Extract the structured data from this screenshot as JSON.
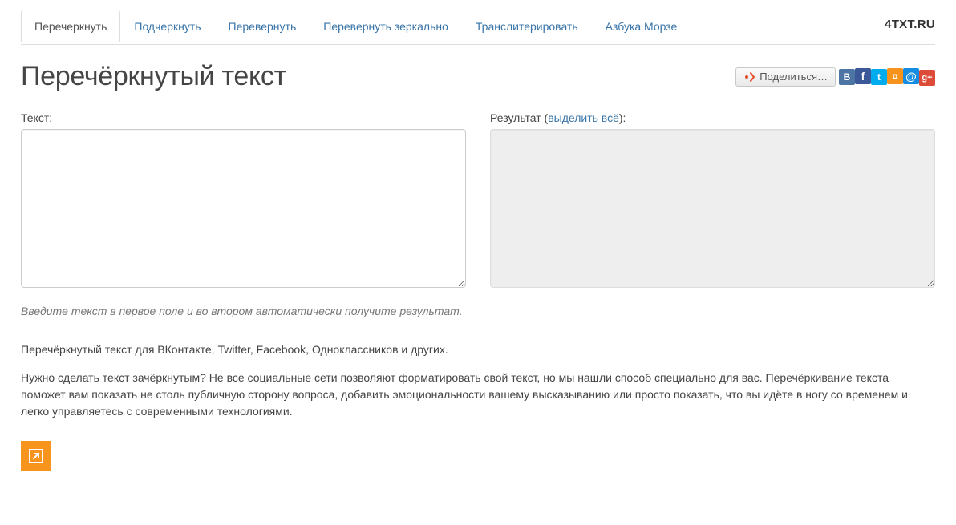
{
  "brand": "4TXT.RU",
  "tabs": [
    {
      "label": "Перечеркнуть",
      "key": "strike",
      "active": true
    },
    {
      "label": "Подчеркнуть",
      "key": "underline",
      "active": false
    },
    {
      "label": "Перевернуть",
      "key": "flip",
      "active": false
    },
    {
      "label": "Перевернуть зеркально",
      "key": "mirror",
      "active": false
    },
    {
      "label": "Транслитерировать",
      "key": "translit",
      "active": false
    },
    {
      "label": "Азбука Морзе",
      "key": "morse",
      "active": false
    }
  ],
  "heading": "Перечёркнутый текст",
  "share": {
    "button_label": "Поделиться…",
    "networks": [
      {
        "key": "vk",
        "glyph": "B"
      },
      {
        "key": "fb",
        "glyph": "f"
      },
      {
        "key": "tw",
        "glyph": "t"
      },
      {
        "key": "ok",
        "glyph": "¤"
      },
      {
        "key": "mr",
        "glyph": "@"
      },
      {
        "key": "gp",
        "glyph": "g+"
      }
    ]
  },
  "form": {
    "input_label": "Текст:",
    "result_label_prefix": "Результат (",
    "result_select_all": "выделить всё",
    "result_label_suffix": "):",
    "input_value": "",
    "result_value": "",
    "hint": "Введите текст в первое поле и во втором автоматически получите результат."
  },
  "paragraphs": [
    "Перечёркнутый текст для ВКонтакте, Twitter, Facebook, Одноклассников и других.",
    "Нужно сделать текст зачёркнутым? Не все социальные сети позволяют форматировать свой текст, но мы нашли способ специально для вас. Перечёркивание текста поможет вам показать не столь публичную сторону вопроса, добавить эмоциональности вашему высказыванию или просто показать, что вы идёте в ногу со временем и легко управляетесь с современными технологиями."
  ]
}
